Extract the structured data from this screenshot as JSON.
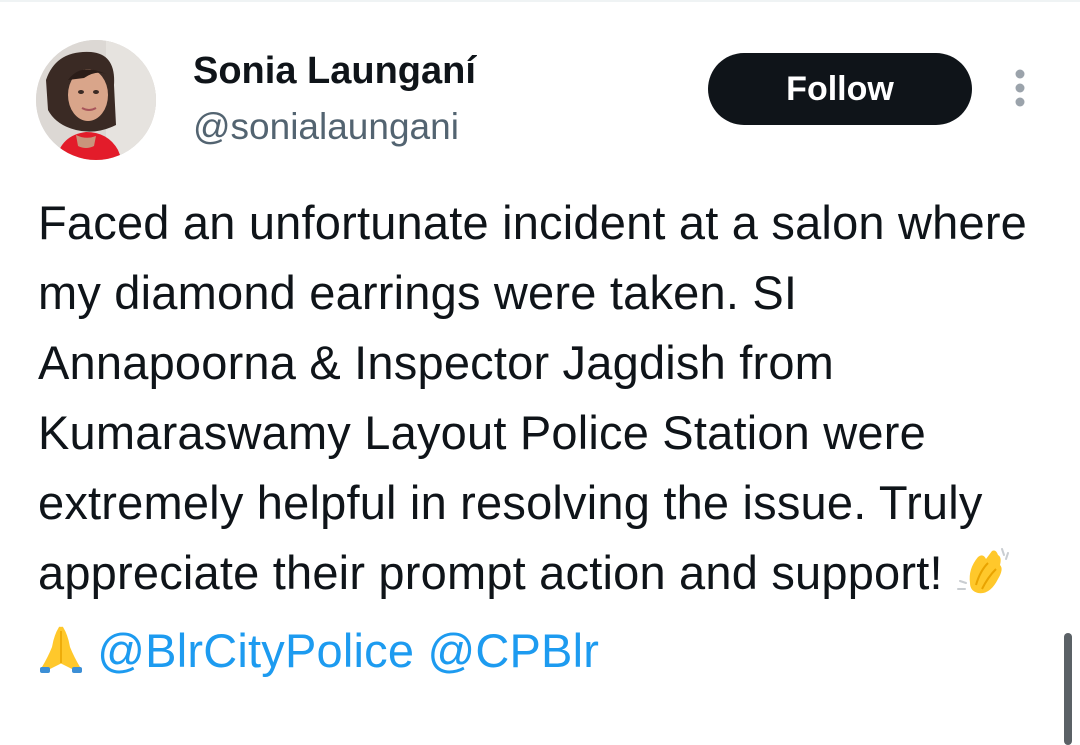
{
  "author": {
    "name": "Sonia Launganí",
    "handle": "@sonialaungani"
  },
  "actions": {
    "follow_label": "Follow"
  },
  "tweet": {
    "text_part1": "Faced an unfortunate incident at a salon where my diamond earrings were taken. SI Annapoorna & Inspector Jagdish from Kumaraswamy Layout Police Station were extremely helpful in resolving the issue. Truly appreciate their prompt action and support!",
    "emojis": [
      "clapping-hands-emoji",
      "folded-hands-emoji"
    ],
    "mention_1": "@BlrCityPolice",
    "mention_2": "@CPBlr"
  },
  "icons": {
    "more": "more-vertical-icon"
  },
  "colors": {
    "text": "#0f1419",
    "secondary_text": "#536471",
    "link": "#1d9bf0",
    "follow_bg": "#0f1419",
    "follow_fg": "#ffffff"
  }
}
